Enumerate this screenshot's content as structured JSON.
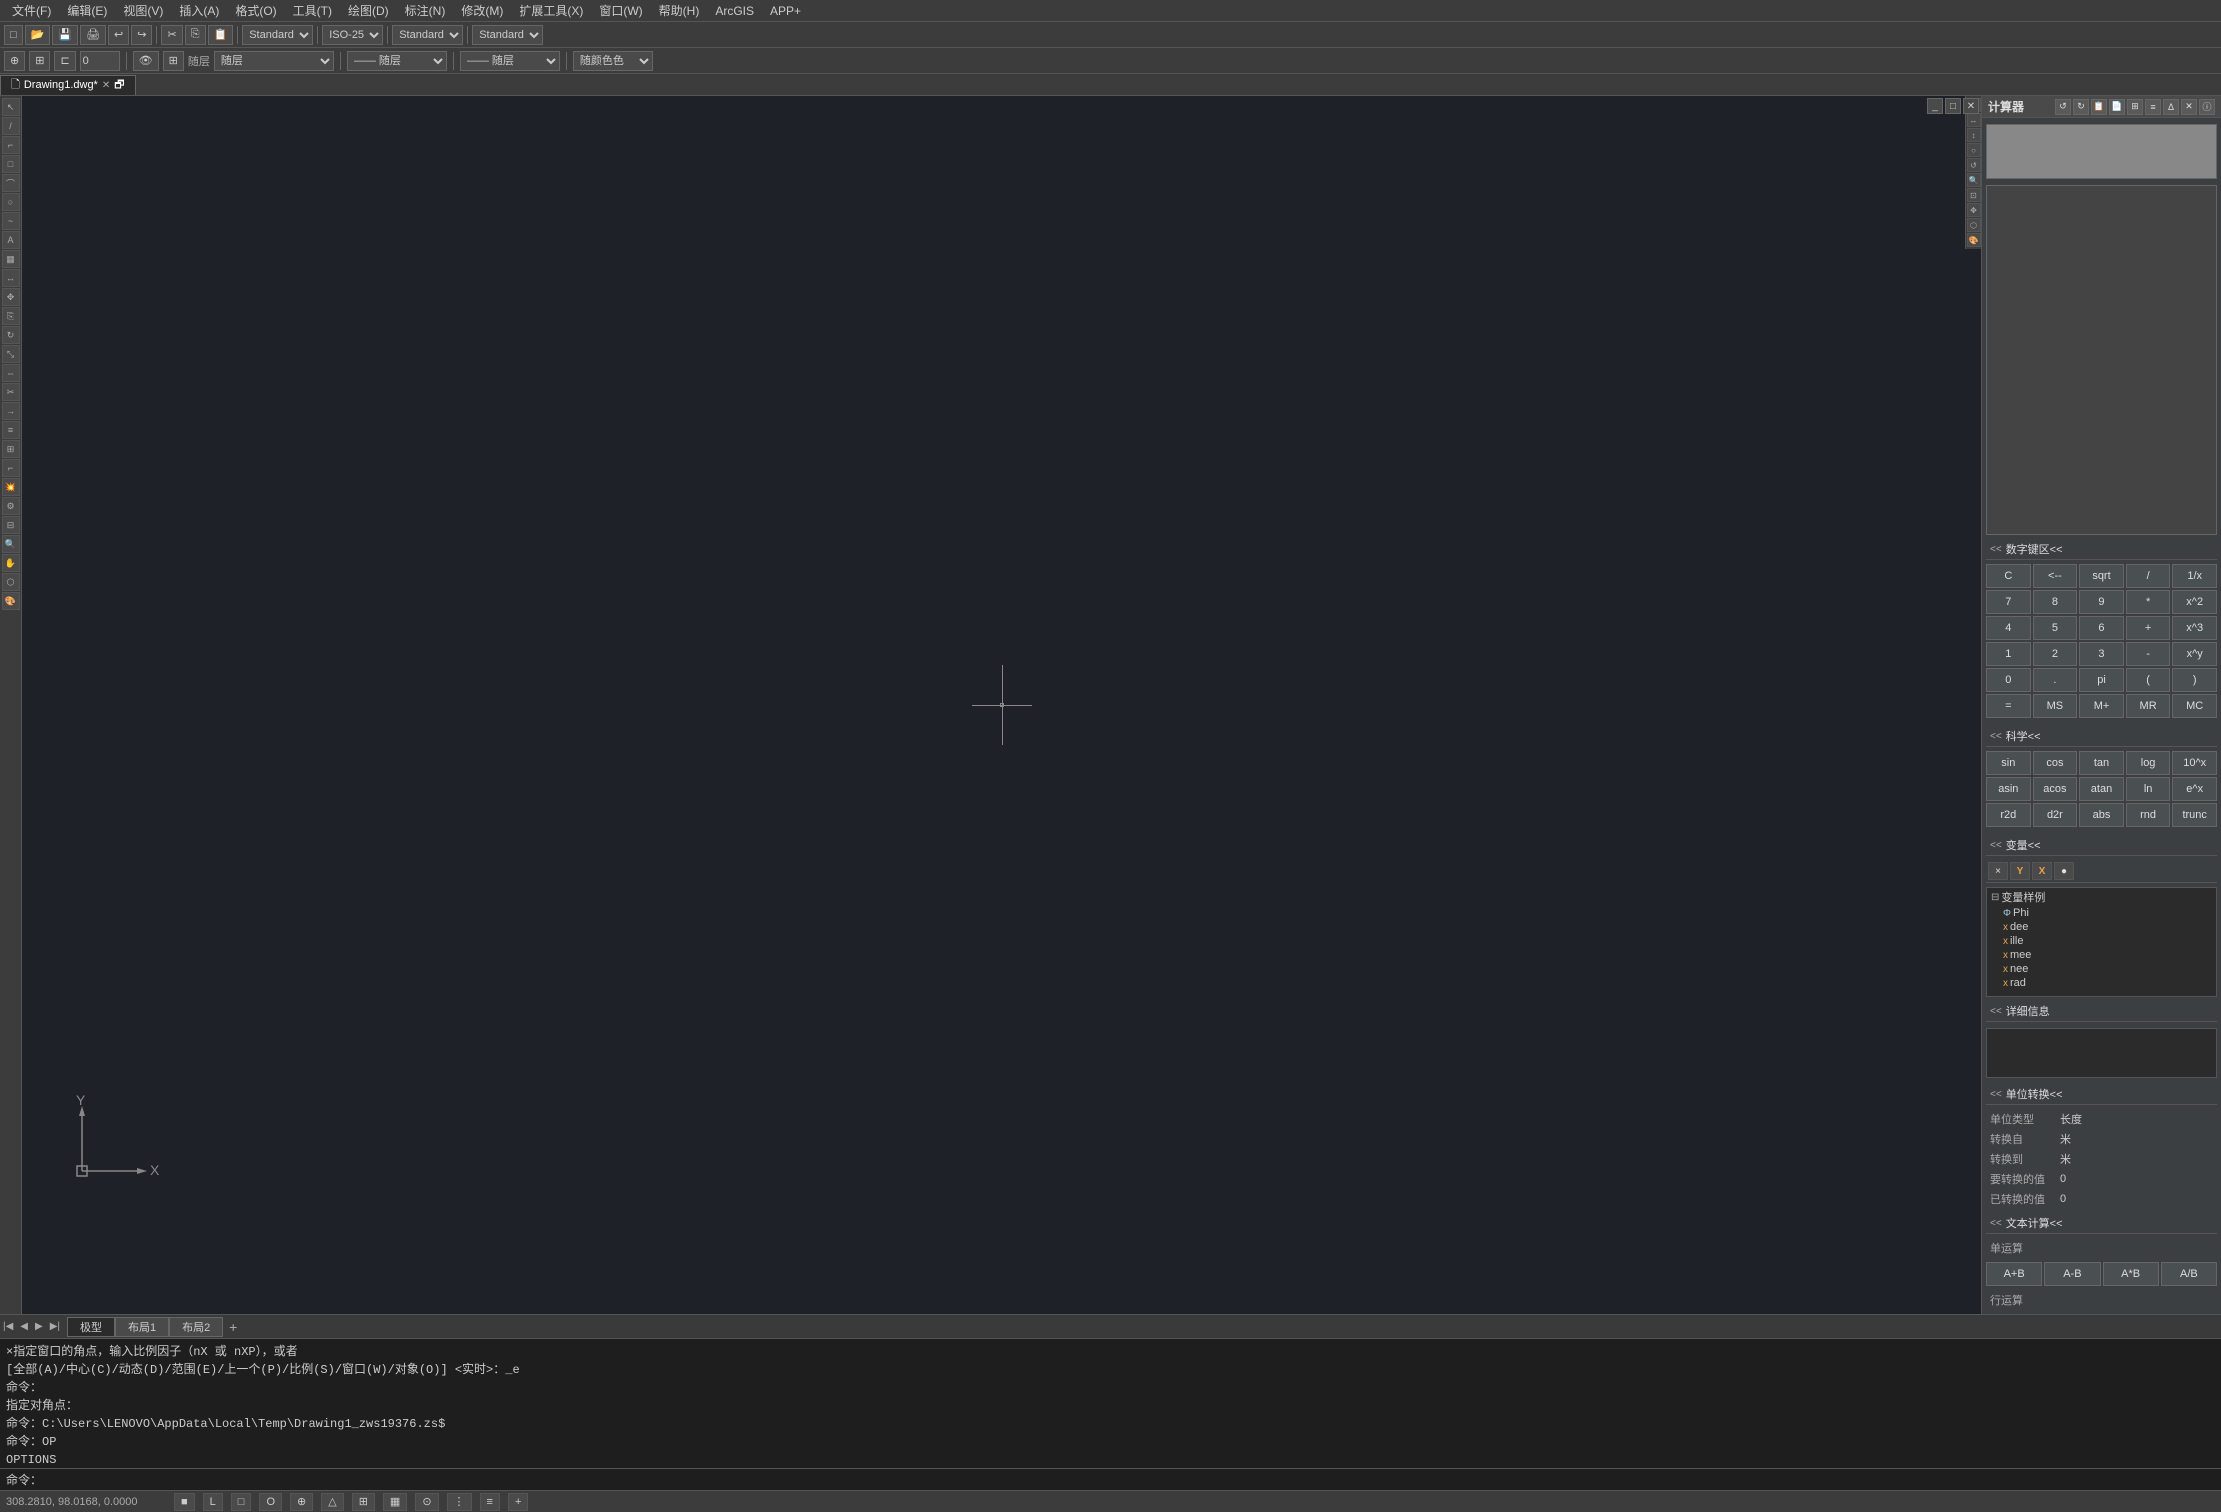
{
  "menubar": {
    "items": [
      "文件(F)",
      "编辑(E)",
      "视图(V)",
      "插入(A)",
      "格式(O)",
      "工具(T)",
      "绘图(D)",
      "标注(N)",
      "修改(M)",
      "扩展工具(X)",
      "窗口(W)",
      "帮助(H)",
      "ArcGIS",
      "APP+"
    ]
  },
  "toolbar": {
    "standard_label": "Standard",
    "iso_label": "ISO-25",
    "standard2_label": "Standard",
    "standard3_label": "Standard",
    "layer_label": "随层",
    "layer2_label": "随层",
    "lineweight_label": "——  随层",
    "linetype_label": "—— 随层",
    "color_label": "随颜色色",
    "input_value": "0"
  },
  "tab": {
    "name": "Drawing1.dwg*"
  },
  "layout_tabs": {
    "model": "极型",
    "layout1": "布局1",
    "layout2": "布局2",
    "add": "+"
  },
  "canvas": {
    "crosshair_x": "X",
    "crosshair_y": "Y",
    "coords": "308.2810, 98.0168, 0.0000"
  },
  "command_history": [
    "×指定窗口的角点，输入比例因子（nX 或 nXP），或者",
    "[全部(A)/中心(C)/动态(D)/范围(E)/上一个(P)/比例(S)/窗口(W)/对象(O)] <实时>：_e",
    "命令：",
    "指定对角点：",
    "命令：C:\\Users\\LENOVO\\AppData\\Local\\Temp\\Drawing1_zws19376.zs$",
    "命令：OP",
    "OPTIONS",
    "命令："
  ],
  "calculator": {
    "title": "计算器",
    "close_btn": "✕",
    "toolbar_icons": [
      "↺",
      "↻",
      "📋",
      "📄",
      "⊞",
      "≡",
      "Δ",
      "✕",
      "ⓘ"
    ],
    "display_value": "",
    "input_value": "",
    "numpad_title": "数字键区<<",
    "buttons_row1": [
      "C",
      "<--",
      "sqrt",
      "/",
      "1/x"
    ],
    "buttons_row2": [
      "7",
      "8",
      "9",
      "*",
      "x^2"
    ],
    "buttons_row3": [
      "4",
      "5",
      "6",
      "+",
      "x^3"
    ],
    "buttons_row4": [
      "1",
      "2",
      "3",
      "-",
      "x^y"
    ],
    "buttons_row5": [
      "0",
      ".",
      "pi",
      "(",
      ")"
    ],
    "buttons_row6": [
      "=",
      "MS",
      "M+",
      "MR",
      "MC"
    ],
    "science_title": "科学<<",
    "science_row1": [
      "sin",
      "cos",
      "tan",
      "log",
      "10^x"
    ],
    "science_row2": [
      "asin",
      "acos",
      "atan",
      "ln",
      "e^x"
    ],
    "science_row3": [
      "r2d",
      "d2r",
      "abs",
      "rnd",
      "trunc"
    ],
    "variables_title": "变量<<",
    "var_toolbar": [
      "×",
      "Y",
      "X̣",
      "●"
    ],
    "var_group": "变量样例",
    "var_items": [
      "Phi",
      "dee",
      "ille",
      "mee",
      "nee",
      "rad"
    ],
    "var_phi_icon": "Φ",
    "var_x_icon": "x",
    "details_title": "详细信息",
    "unit_title": "单位转换<<",
    "unit_type_label": "单位类型",
    "unit_type_value": "长度",
    "convert_from_label": "转换自",
    "convert_from_value": "米",
    "convert_to_label": "转换到",
    "convert_to_value": "米",
    "convert_value_label": "要转换的值",
    "convert_value": "0",
    "converted_label": "已转换的值",
    "converted_value": "0",
    "text_calc_title": "文本计算<<",
    "single_ops": "单运算",
    "text_btns": [
      "A+B",
      "A-B",
      "A*B",
      "A/B"
    ],
    "row_ops": "行运算"
  },
  "status_bar": {
    "coords": "308.2810, 98.0168, 0.0000",
    "buttons": [
      "■",
      "L",
      "□",
      "O",
      "⊕",
      "△",
      "⊞",
      "▦",
      "⊙",
      "⋮",
      "≡",
      "+"
    ]
  }
}
